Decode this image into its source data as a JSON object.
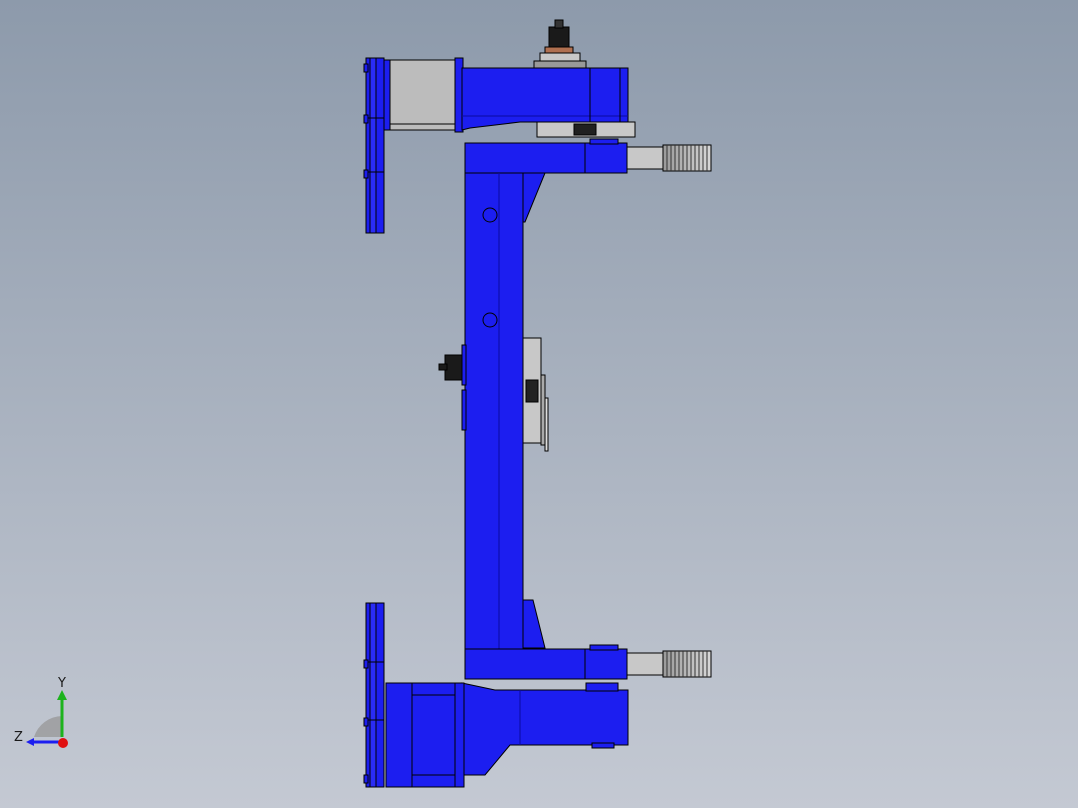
{
  "viewport": {
    "background_top": "#8d9aab",
    "background_bottom": "#c4c9d3",
    "part_color": "#1c1ef0",
    "part_edge": "#000000",
    "steel_color": "#c0c0c0"
  },
  "triad": {
    "y_label": "Y",
    "z_label": "Z",
    "y_color": "#1db31d",
    "z_color": "#1c1ef0",
    "origin_color": "#e01010"
  }
}
